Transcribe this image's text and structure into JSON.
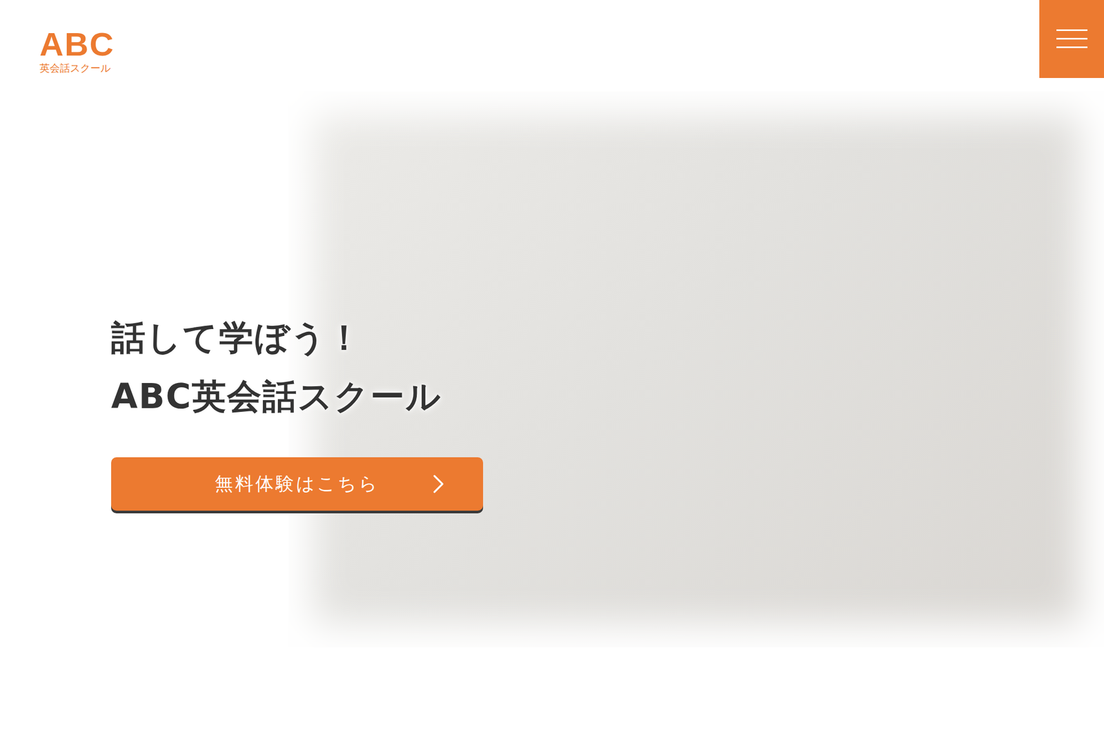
{
  "logo": {
    "mark": "ABC",
    "sub": "英会話スクール"
  },
  "hero": {
    "title_lines": [
      "話して学ぼう！",
      "ABC英会話スクール"
    ],
    "cta": {
      "label": "無料体験はこちら"
    }
  }
}
